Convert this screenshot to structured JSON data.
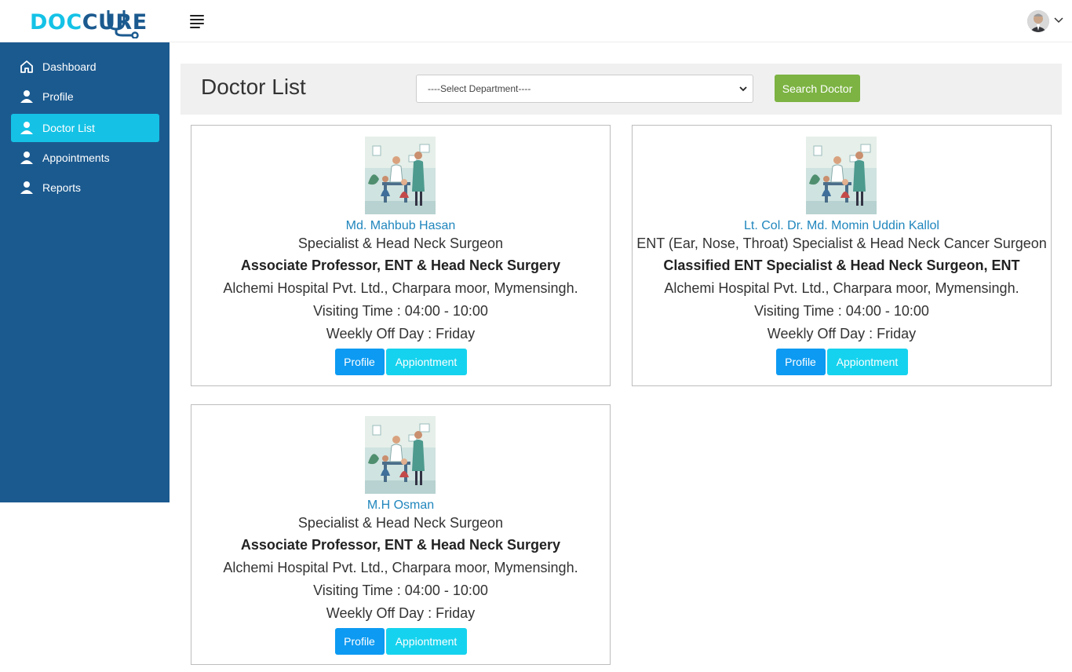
{
  "header": {
    "logo_part1": "DOC",
    "logo_part2": "CURE",
    "menu_icon": "hamburger-menu-icon",
    "avatar_icon": "user-avatar",
    "caret_icon": "chevron-down-icon"
  },
  "sidebar": {
    "items": [
      {
        "label": "Dashboard",
        "icon": "home-icon",
        "active": false
      },
      {
        "label": "Profile",
        "icon": "user-icon",
        "active": false
      },
      {
        "label": "Doctor List",
        "icon": "user-icon",
        "active": true
      },
      {
        "label": "Appointments",
        "icon": "user-icon",
        "active": false
      },
      {
        "label": "Reports",
        "icon": "user-icon",
        "active": false
      }
    ],
    "bg_color": "#1b5a8f",
    "active_color": "#15c2e6"
  },
  "main": {
    "title": "Doctor List",
    "department_select": "----Select Department----",
    "search_button": "Search Doctor",
    "doctors": [
      {
        "name": "Md. Mahbub Hasan",
        "specialty": "Specialist & Head Neck Surgeon",
        "designation": "Associate Professor, ENT & Head Neck Surgery",
        "hospital": "Alchemi Hospital Pvt. Ltd., Charpara moor, Mymensingh.",
        "visiting_time": "Visiting Time : 04:00 - 10:00",
        "off_day": "Weekly Off Day : Friday",
        "profile_button": "Profile",
        "appointment_button": "Appiontment"
      },
      {
        "name": "Lt. Col. Dr. Md. Momin Uddin Kallol",
        "specialty": "ENT (Ear, Nose, Throat) Specialist & Head Neck Cancer Surgeon",
        "designation": "Classified ENT Specialist & Head Neck Surgeon, ENT",
        "hospital": "Alchemi Hospital Pvt. Ltd., Charpara moor, Mymensingh.",
        "visiting_time": "Visiting Time : 04:00 - 10:00",
        "off_day": "Weekly Off Day : Friday",
        "profile_button": "Profile",
        "appointment_button": "Appiontment"
      },
      {
        "name": "M.H Osman",
        "specialty": "Specialist & Head Neck Surgeon",
        "designation": "Associate Professor, ENT & Head Neck Surgery",
        "hospital": "Alchemi Hospital Pvt. Ltd., Charpara moor, Mymensingh.",
        "visiting_time": "Visiting Time : 04:00 - 10:00",
        "off_day": "Weekly Off Day : Friday",
        "profile_button": "Profile",
        "appointment_button": "Appiontment"
      }
    ]
  },
  "colors": {
    "accent": "#15c2e6",
    "search_button": "#7cb342",
    "profile_button": "#0d9af2",
    "appointment_button": "#15d3ee",
    "doctor_name": "#2086bd"
  }
}
